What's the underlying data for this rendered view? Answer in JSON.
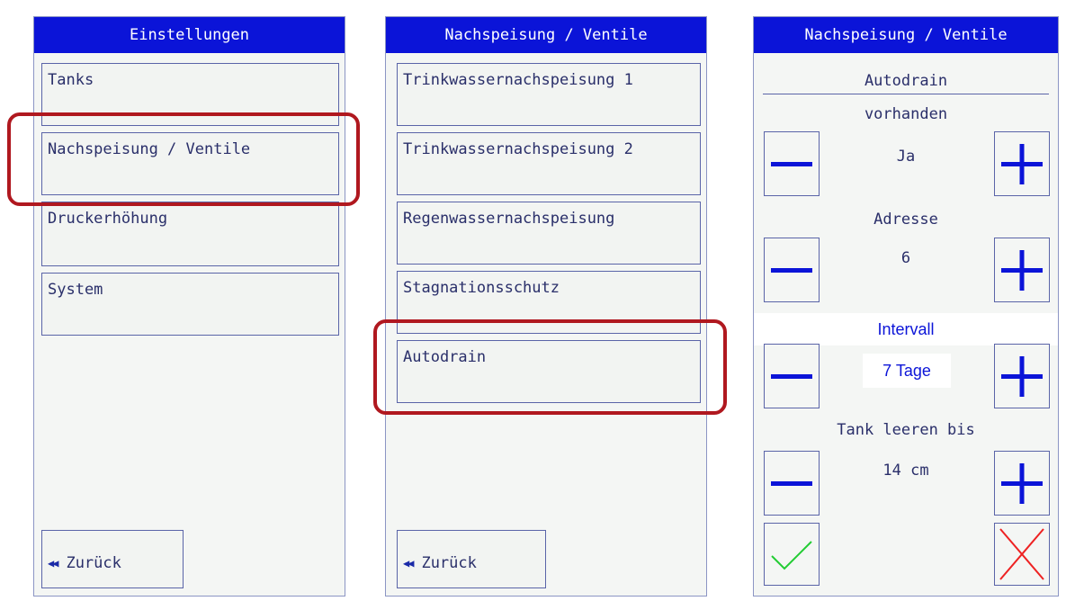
{
  "panel1": {
    "title": "Einstellungen",
    "items": [
      "Tanks",
      "Nachspeisung / Ventile",
      "Druckerhöhung",
      "System"
    ],
    "back_label": "Zurück"
  },
  "panel2": {
    "title": "Nachspeisung / Ventile",
    "items": [
      "Trinkwassernachspeisung 1",
      "Trinkwassernachspeisung 2",
      "Regenwassernachspeisung",
      "Stagnationsschutz",
      "Autodrain"
    ],
    "back_label": "Zurück"
  },
  "panel3": {
    "title": "Nachspeisung / Ventile",
    "heading": "Autodrain",
    "settings": [
      {
        "label": "vorhanden",
        "value": "Ja"
      },
      {
        "label": "Adresse",
        "value": "6"
      },
      {
        "label": "Intervall",
        "value": "7 Tage"
      },
      {
        "label": "Tank leeren bis",
        "value": "14 cm"
      }
    ]
  },
  "colors": {
    "titlebar": "#0b14d8",
    "highlight": "#b0181f",
    "confirm": "#22cc33",
    "cancel": "#ee2222"
  },
  "icons": {
    "back": "double-left-arrow-icon",
    "minus": "minus-icon",
    "plus": "plus-icon",
    "confirm": "checkmark-icon",
    "cancel": "cross-icon"
  }
}
